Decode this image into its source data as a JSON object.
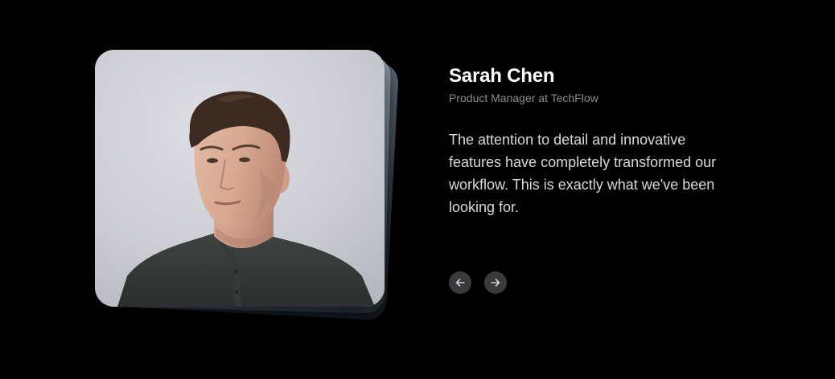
{
  "testimonial": {
    "name": "Sarah Chen",
    "role": "Product Manager at TechFlow",
    "quote": "The attention to detail and innovative features have completely transformed our workflow. This is exactly what we've been looking for."
  },
  "navigation": {
    "prev_icon": "arrow-left-icon",
    "next_icon": "arrow-right-icon"
  },
  "colors": {
    "background": "#000000",
    "name_text": "#ffffff",
    "role_text": "#8b8b8f",
    "quote_text": "#d9d9dc",
    "nav_button_bg": "#3a3a3d",
    "nav_icon": "#d0d0d3"
  }
}
